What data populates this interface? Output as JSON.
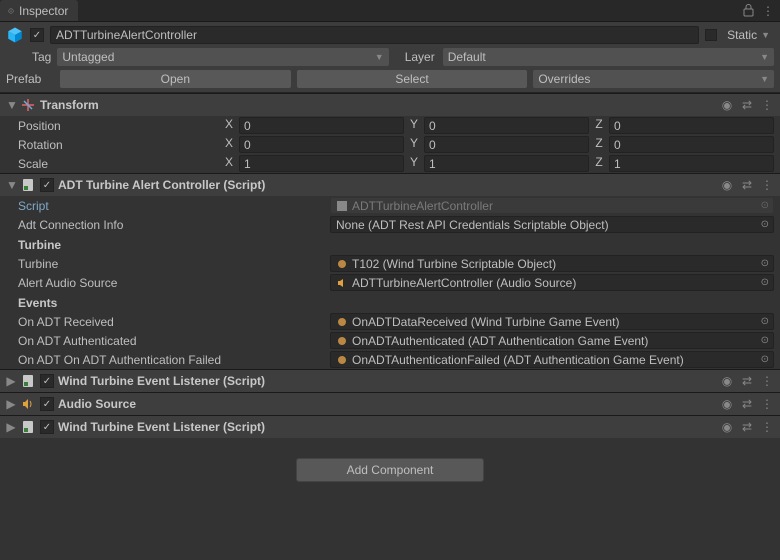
{
  "titlebar": {
    "tab_label": "Inspector"
  },
  "gameobject": {
    "name": "ADTTurbineAlertController",
    "static_label": "Static",
    "tag_label": "Tag",
    "tag_value": "Untagged",
    "layer_label": "Layer",
    "layer_value": "Default",
    "prefab_label": "Prefab",
    "open_label": "Open",
    "select_label": "Select",
    "overrides_label": "Overrides"
  },
  "transform": {
    "title": "Transform",
    "position_label": "Position",
    "rotation_label": "Rotation",
    "scale_label": "Scale",
    "position": {
      "x": "0",
      "y": "0",
      "z": "0"
    },
    "rotation": {
      "x": "0",
      "y": "0",
      "z": "0"
    },
    "scale": {
      "x": "1",
      "y": "1",
      "z": "1"
    }
  },
  "alert": {
    "title": "ADT Turbine Alert Controller (Script)",
    "script_label": "Script",
    "script_value": "ADTTurbineAlertController",
    "adt_conn_label": "Adt Connection Info",
    "adt_conn_value": "None (ADT Rest API Credentials Scriptable Object)",
    "turbine_section": "Turbine",
    "turbine_label": "Turbine",
    "turbine_value": "T102 (Wind Turbine Scriptable Object)",
    "alert_audio_label": "Alert Audio Source",
    "alert_audio_value": "ADTTurbineAlertController (Audio Source)",
    "events_section": "Events",
    "on_received_label": "On ADT Received",
    "on_received_value": "OnADTDataReceived (Wind Turbine Game Event)",
    "on_auth_label": "On ADT Authenticated",
    "on_auth_value": "OnADTAuthenticated (ADT Authentication Game Event)",
    "on_auth_fail_label": "On ADT On ADT Authentication Failed",
    "on_auth_fail_value": "OnADTAuthenticationFailed (ADT Authentication Game Event)"
  },
  "collapsed1": {
    "title": "Wind Turbine Event Listener (Script)"
  },
  "collapsed2": {
    "title": "Audio Source"
  },
  "collapsed3": {
    "title": "Wind Turbine Event Listener (Script)"
  },
  "add_component_label": "Add Component"
}
